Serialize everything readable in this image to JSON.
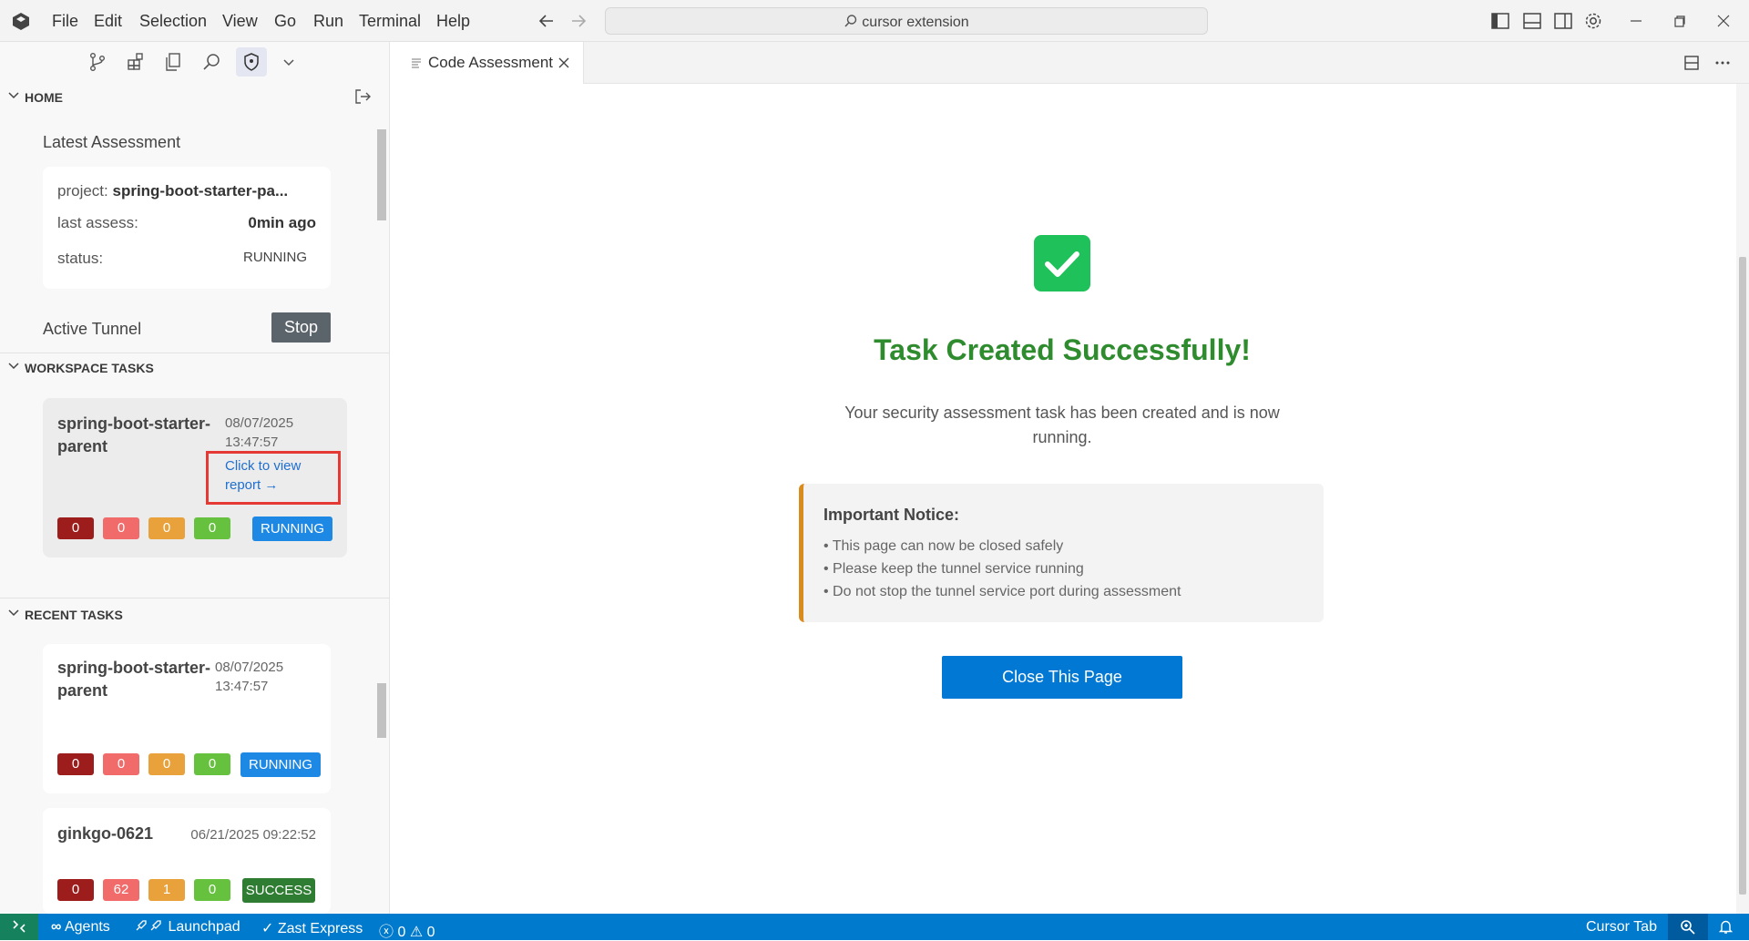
{
  "menu": [
    "File",
    "Edit",
    "Selection",
    "View",
    "Go",
    "Run",
    "Terminal",
    "Help"
  ],
  "command_center": {
    "text": "cursor extension",
    "icon": "search-icon"
  },
  "sidebar": {
    "home": {
      "header": "HOME",
      "latest_title": "Latest Assessment",
      "project_label": "project:",
      "project_value": "spring-boot-starter-pa...",
      "last_assess_label": "last assess:",
      "last_assess_value": "0min ago",
      "status_label": "status:",
      "status_value": "RUNNING",
      "tunnel_label": "Active Tunnel",
      "stop_label": "Stop"
    },
    "workspace": {
      "header": "WORKSPACE TASKS",
      "task": {
        "name": "spring-boot-starter-parent",
        "date": "08/07/2025",
        "time": "13:47:57",
        "view_report": "Click to view report →",
        "counts": [
          "0",
          "0",
          "0",
          "0"
        ],
        "status": "RUNNING"
      }
    },
    "recent": {
      "header": "RECENT TASKS",
      "tasks": [
        {
          "name": "spring-boot-starter-parent",
          "date": "08/07/2025",
          "time": "13:47:57",
          "counts": [
            "0",
            "0",
            "0",
            "0"
          ],
          "status": "RUNNING"
        },
        {
          "name": "ginkgo-0621",
          "datetime": "06/21/2025 09:22:52",
          "counts": [
            "0",
            "62",
            "1",
            "0"
          ],
          "status": "SUCCESS"
        }
      ]
    }
  },
  "tab": {
    "label": "Code Assessment"
  },
  "content": {
    "title": "Task Created Successfully!",
    "message_line1": "Your security assessment task has been created and is now",
    "message_line2": "running.",
    "notice_title": "Important Notice:",
    "notice_items": [
      "• This page can now be closed safely",
      "• Please keep the tunnel service running",
      "• Do not stop the tunnel service port during assessment"
    ],
    "close_label": "Close This Page"
  },
  "statusbar": {
    "agents": "Agents",
    "launchpad": "Launchpad",
    "zast": "Zast Express",
    "errors": "0",
    "warnings": "0",
    "cursor_tab": "Cursor Tab"
  },
  "colors": {
    "accent": "#007acc",
    "success_title": "#2e8b2e",
    "check": "#1fc15a",
    "running": "#1e88e5",
    "success": "#2e7d32",
    "highlight": "#e53935",
    "notice_border": "#d98b1b"
  }
}
